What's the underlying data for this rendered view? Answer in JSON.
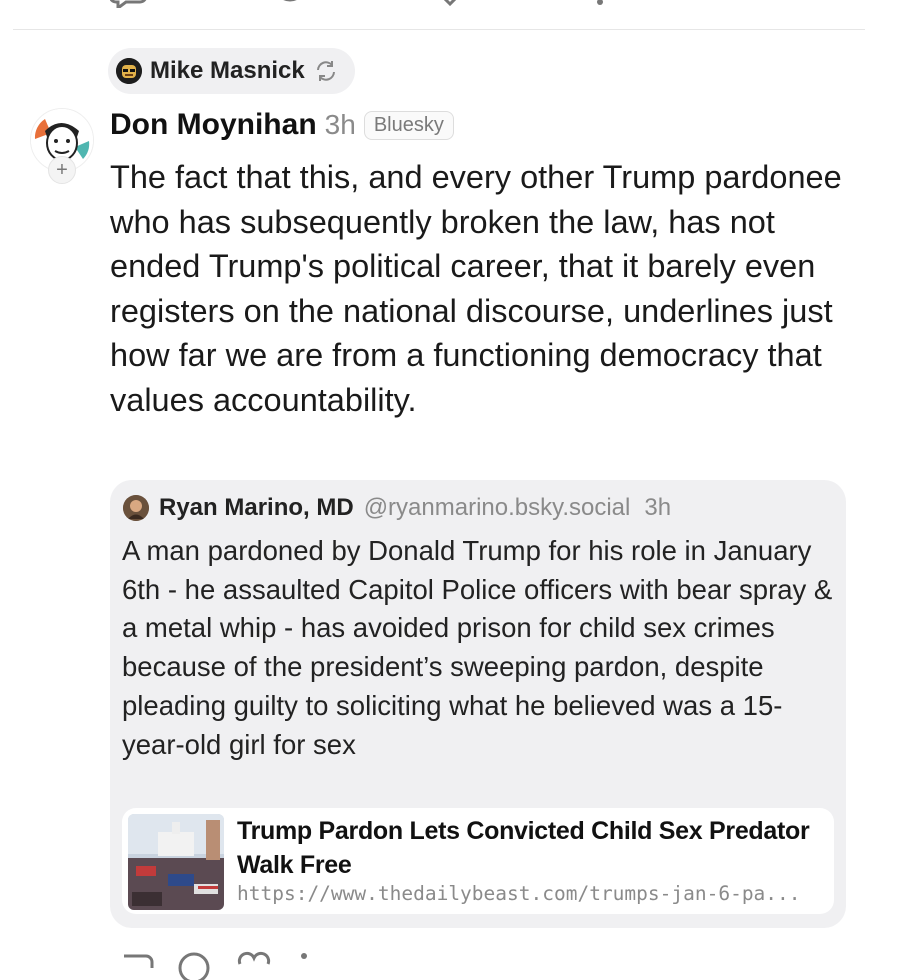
{
  "reposted_by": {
    "name": "Mike Masnick"
  },
  "post": {
    "author": "Don Moynihan",
    "time": "3h",
    "badge": "Bluesky",
    "body": "The fact that this, and every other Trump pardonee who has subsequently broken the law, has not ended Trump's political career, that it barely even registers on the national discourse, underlines just how far we are from a functioning democracy that values accountability."
  },
  "quote": {
    "author": "Ryan Marino, MD",
    "handle": "@ryanmarino.bsky.social",
    "time": "3h",
    "body": "A man pardoned by Donald Trump for his role in January 6th - he assaulted Capitol Police officers with bear spray & a metal whip - has avoided prison for child sex crimes because of the president’s sweeping pardon, despite pleading guilty to soliciting what he believed was a 15-year-old girl for sex",
    "link": {
      "title": "Trump Pardon Lets Convicted Child Sex Predator Walk Free",
      "url": "https://www.thedailybeast.com/trumps-jan-6-pa..."
    }
  },
  "icons": {
    "repost": "repost-icon",
    "reply": "reply-icon",
    "like": "heart-icon",
    "more": "more-icon",
    "follow": "plus-icon"
  },
  "colors": {
    "text": "#1a1a1a",
    "muted": "#8a8a8a",
    "card_bg": "#f0f0f2"
  }
}
